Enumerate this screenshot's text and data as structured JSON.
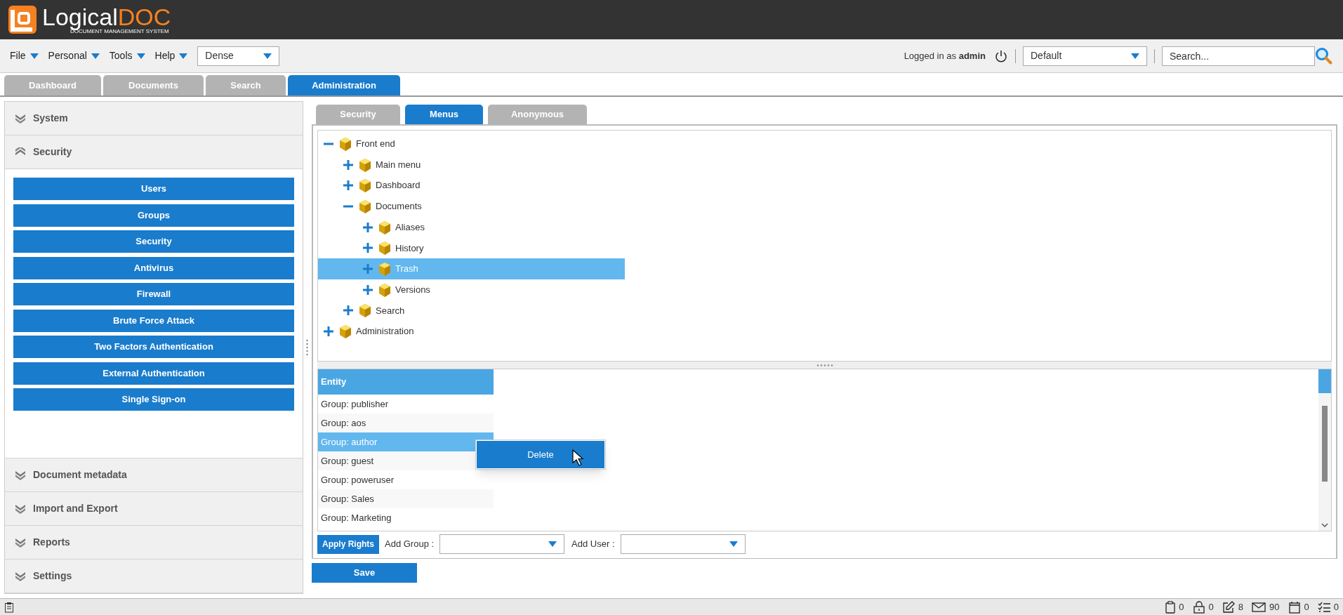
{
  "app": {
    "logo_main": "Logical",
    "logo_accent": "DOC",
    "logo_tagline": "DOCUMENT MANAGEMENT SYSTEM"
  },
  "menu_bar": {
    "menus": [
      "File",
      "Personal",
      "Tools",
      "Help"
    ],
    "density_select": "Dense",
    "logged_in_prefix": "Logged in as",
    "user": "admin",
    "workspace_select": "Default",
    "search": {
      "placeholder": "Search..."
    }
  },
  "main_tabs": [
    {
      "label": "Dashboard",
      "selected": false
    },
    {
      "label": "Documents",
      "selected": false
    },
    {
      "label": "Search",
      "selected": false
    },
    {
      "label": "Administration",
      "selected": true
    }
  ],
  "sidebar": {
    "sections": [
      {
        "title": "System",
        "expanded": false
      },
      {
        "title": "Security",
        "expanded": true,
        "items": [
          "Users",
          "Groups",
          "Security",
          "Antivirus",
          "Firewall",
          "Brute Force Attack",
          "Two Factors Authentication",
          "External Authentication",
          "Single Sign-on"
        ]
      },
      {
        "title": "Document metadata",
        "expanded": false
      },
      {
        "title": "Import and Export",
        "expanded": false
      },
      {
        "title": "Reports",
        "expanded": false
      },
      {
        "title": "Settings",
        "expanded": false
      }
    ]
  },
  "sub_tabs": [
    {
      "label": "Security",
      "selected": false
    },
    {
      "label": "Menus",
      "selected": true
    },
    {
      "label": "Anonymous",
      "selected": false
    }
  ],
  "menu_tree": [
    {
      "label": "Front end",
      "expanded": true,
      "selected": false,
      "children": [
        {
          "label": "Main menu",
          "expanded": false,
          "selected": false
        },
        {
          "label": "Dashboard",
          "expanded": false,
          "selected": false
        },
        {
          "label": "Documents",
          "expanded": true,
          "selected": false,
          "children": [
            {
              "label": "Aliases",
              "expanded": false,
              "selected": false
            },
            {
              "label": "History",
              "expanded": false,
              "selected": false
            },
            {
              "label": "Trash",
              "expanded": false,
              "selected": true
            },
            {
              "label": "Versions",
              "expanded": false,
              "selected": false
            }
          ]
        },
        {
          "label": "Search",
          "expanded": false,
          "selected": false
        }
      ]
    },
    {
      "label": "Administration",
      "expanded": false,
      "selected": false
    }
  ],
  "rights_table": {
    "columns": [
      "Entity"
    ],
    "rows": [
      {
        "entity": "Group: publisher",
        "selected": false
      },
      {
        "entity": "Group: aos",
        "selected": false
      },
      {
        "entity": "Group: author",
        "selected": true
      },
      {
        "entity": "Group: guest",
        "selected": false
      },
      {
        "entity": "Group: poweruser",
        "selected": false
      },
      {
        "entity": "Group: Sales",
        "selected": false
      },
      {
        "entity": "Group: Marketing",
        "selected": false
      }
    ]
  },
  "context_menu": {
    "items": [
      "Delete"
    ]
  },
  "rights_bar": {
    "apply_button": "Apply Rights",
    "add_group_label": "Add Group :",
    "add_user_label": "Add User :"
  },
  "save_button": "Save",
  "status_bar": [
    {
      "kind": "clipboard",
      "count": "0"
    },
    {
      "kind": "lock",
      "count": "0"
    },
    {
      "kind": "edit",
      "count": "8"
    },
    {
      "kind": "mail",
      "count": "90"
    },
    {
      "kind": "calendar",
      "count": "0"
    },
    {
      "kind": "tasks",
      "count": "0"
    }
  ]
}
